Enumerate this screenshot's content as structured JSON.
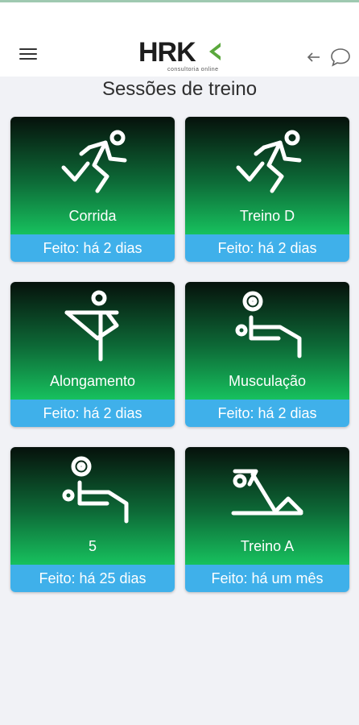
{
  "header": {
    "logo_text": "HRK",
    "logo_sub": "consultoria online",
    "accent": "#5aa83c"
  },
  "page": {
    "title": "Sessões de treino"
  },
  "colors": {
    "card_gradient_top": "#06110b",
    "card_gradient_bottom": "#17c15e",
    "status_bar": "#3fb0ea"
  },
  "sessions": [
    {
      "name": "Corrida",
      "status": "Feito: há 2 dias",
      "icon": "runner-icon"
    },
    {
      "name": "Treino D",
      "status": "Feito: há 2 dias",
      "icon": "runner-icon"
    },
    {
      "name": "Alongamento",
      "status": "Feito: há 2 dias",
      "icon": "stretching-icon"
    },
    {
      "name": "Musculação",
      "status": "Feito: há 2 dias",
      "icon": "weightlifting-icon"
    },
    {
      "name": "5",
      "status": "Feito: há 25 dias",
      "icon": "weightlifting-icon"
    },
    {
      "name": "Treino A",
      "status": "Feito: há um mês",
      "icon": "situp-icon"
    }
  ]
}
